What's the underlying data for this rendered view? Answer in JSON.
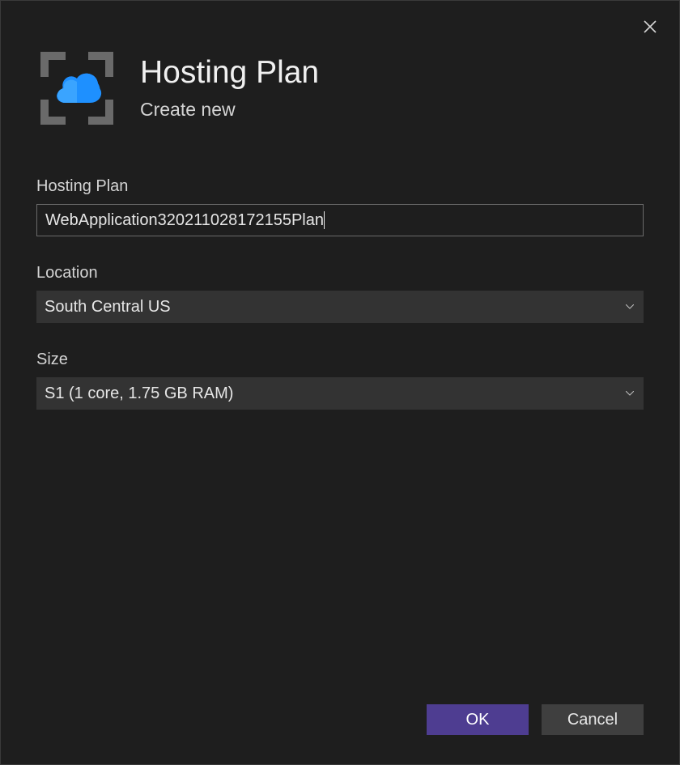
{
  "header": {
    "title": "Hosting Plan",
    "subtitle": "Create new"
  },
  "form": {
    "hosting_plan": {
      "label": "Hosting Plan",
      "value": "WebApplication320211028172155Plan"
    },
    "location": {
      "label": "Location",
      "value": "South Central US"
    },
    "size": {
      "label": "Size",
      "value": "S1 (1 core, 1.75 GB RAM)"
    }
  },
  "footer": {
    "ok": "OK",
    "cancel": "Cancel"
  }
}
